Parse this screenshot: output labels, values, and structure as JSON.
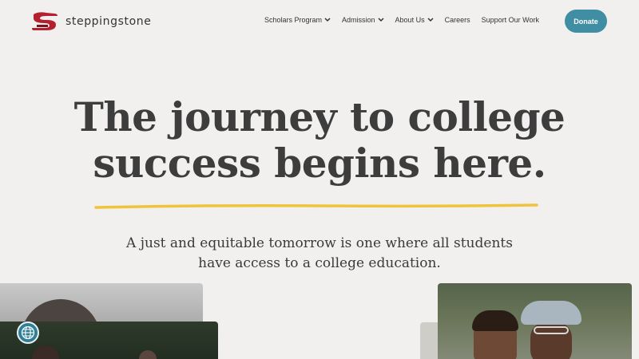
{
  "brand": {
    "name": "steppingstone",
    "logo_color": "#b5202e"
  },
  "nav": {
    "items": [
      {
        "label": "Scholars Program",
        "dropdown": true
      },
      {
        "label": "Admission",
        "dropdown": true
      },
      {
        "label": "About Us",
        "dropdown": true
      },
      {
        "label": "Careers",
        "dropdown": false
      },
      {
        "label": "Support Our Work",
        "dropdown": false
      }
    ],
    "donate_label": "Donate",
    "donate_color": "#3f8ea3"
  },
  "hero": {
    "title_line1": "The journey to college",
    "title_line2": "success begins here.",
    "subtitle_line1": "A just and equitable tomorrow is one where all students",
    "subtitle_line2": "have access to a college education.",
    "underline_color": "#f0c33c"
  },
  "icons": {
    "logo": "steppingstone-logo-icon",
    "chevron": "chevron-down-icon",
    "language": "globe-icon"
  }
}
